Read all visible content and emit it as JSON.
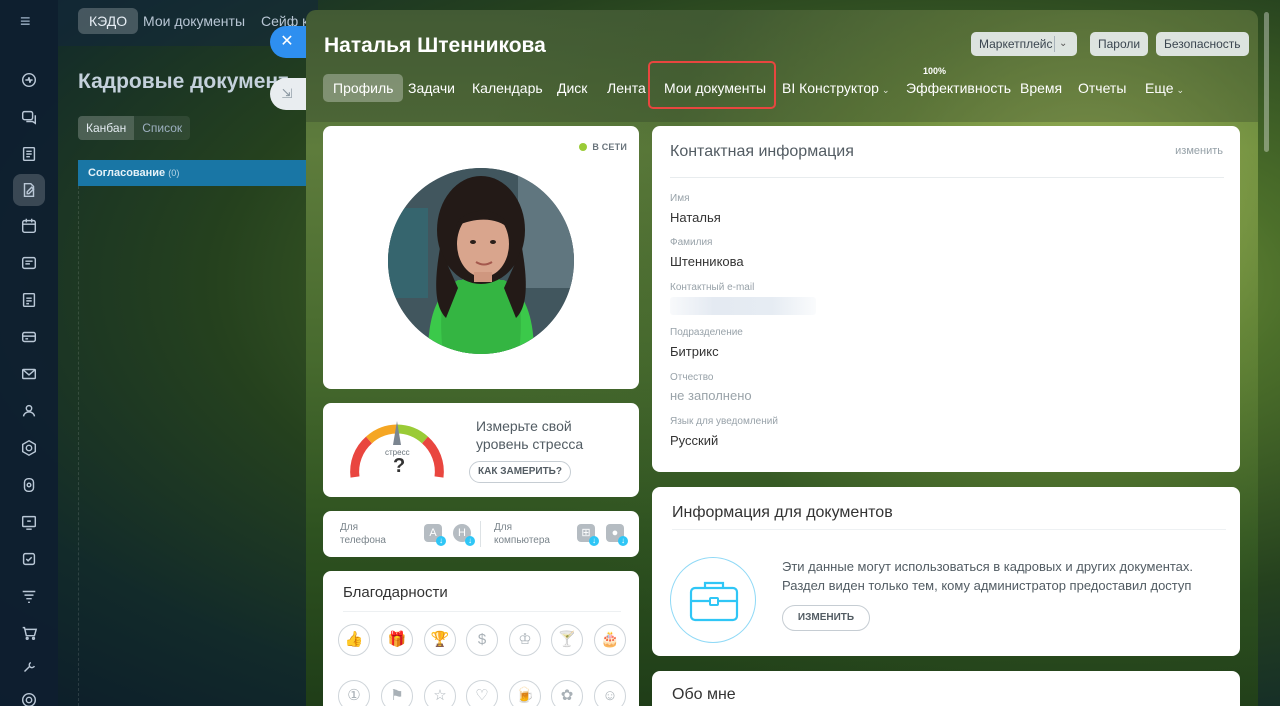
{
  "background_page": {
    "tabs": [
      "КЭДО",
      "Мои документы",
      "Сейф ко"
    ],
    "title": "Кадровые документ",
    "view_switch": [
      "Канбан",
      "Список"
    ],
    "column": {
      "name": "Согласование",
      "count": "(0)"
    }
  },
  "sidebar": {
    "icons": [
      "menu-icon",
      "pulse-icon",
      "chat-icon",
      "news-icon",
      "kedo-icon",
      "calendar-icon",
      "disk-icon",
      "tasks-icon",
      "crm-icon",
      "mail-icon",
      "group-icon",
      "hexagon-icon",
      "gear-icon",
      "video-icon",
      "checklist-icon",
      "filter-icon",
      "cart-icon",
      "wrench-icon",
      "settings-icon"
    ]
  },
  "profile": {
    "name": "Наталья Штенникова",
    "header_buttons": {
      "marketplace": "Маркетплейс",
      "passwords": "Пароли",
      "security": "Безопасность"
    },
    "nav": {
      "profile": "Профиль",
      "tasks": "Задачи",
      "calendar": "Календарь",
      "disk": "Диск",
      "feed": "Лента",
      "my_documents": "Мои документы",
      "bi": "BI Конструктор",
      "efficiency": "Эффективность",
      "efficiency_value": "100%",
      "time": "Время",
      "reports": "Отчеты",
      "more": "Еще"
    },
    "status": "В СЕТИ",
    "stress": {
      "text": "Измерьте свой уровень стресса",
      "gauge_label": "стресс",
      "value": "?",
      "button": "КАК ЗАМЕРИТЬ?"
    },
    "apps": {
      "phone": "Для телефона",
      "computer": "Для компьютера"
    },
    "thanks": {
      "title": "Благодарности"
    }
  },
  "contact": {
    "title": "Контактная информация",
    "edit": "изменить",
    "fields": [
      {
        "label": "Имя",
        "value": "Наталья"
      },
      {
        "label": "Фамилия",
        "value": "Штенникова"
      },
      {
        "label": "Контактный e-mail",
        "value": ""
      },
      {
        "label": "Подразделение",
        "value": "Битрикс"
      },
      {
        "label": "Отчество",
        "value": "не заполнено"
      },
      {
        "label": "Язык для уведомлений",
        "value": "Русский"
      }
    ]
  },
  "documents": {
    "title": "Информация для документов",
    "text": "Эти данные могут использоваться в кадровых и других документах. Раздел виден только тем, кому администратор предоставил доступ",
    "button": "ИЗМЕНИТЬ"
  },
  "about": {
    "title": "Обо мне"
  },
  "colors": {
    "accent": "#2fc6f6",
    "online": "#9acb37",
    "highlight": "#e8463f",
    "close_button": "#2e8ff0"
  }
}
